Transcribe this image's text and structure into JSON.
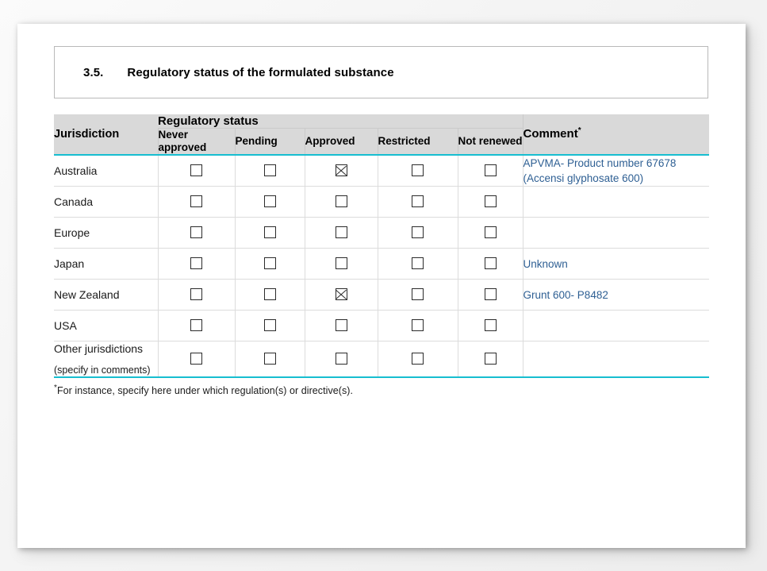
{
  "document": {
    "section_number": "3.5.",
    "section_title": "Regulatory status of the formulated substance"
  },
  "table": {
    "group_header": "Regulatory status",
    "jurisdiction_header": "Jurisdiction",
    "comment_header": "Comment",
    "comment_header_marker": "*",
    "status_columns": [
      "Never approved",
      "Pending",
      "Approved",
      "Restricted",
      "Not renewed"
    ],
    "rows": [
      {
        "jurisdiction": "Australia",
        "jurisdiction_sub": "",
        "never_approved": "unchecked",
        "pending": "unchecked",
        "approved": "checked",
        "restricted": "unchecked",
        "not_renewed": "unchecked",
        "comment": "APVMA- Product number 67678 (Accensi glyphosate 600)"
      },
      {
        "jurisdiction": "Canada",
        "jurisdiction_sub": "",
        "never_approved": "unchecked",
        "pending": "unchecked",
        "approved": "unchecked",
        "restricted": "unchecked",
        "not_renewed": "unchecked",
        "comment": ""
      },
      {
        "jurisdiction": "Europe",
        "jurisdiction_sub": "",
        "never_approved": "unchecked",
        "pending": "unchecked",
        "approved": "unchecked",
        "restricted": "unchecked",
        "not_renewed": "unchecked",
        "comment": ""
      },
      {
        "jurisdiction": "Japan",
        "jurisdiction_sub": "",
        "never_approved": "unchecked",
        "pending": "unchecked",
        "approved": "unchecked",
        "restricted": "unchecked",
        "not_renewed": "unchecked",
        "comment": "Unknown"
      },
      {
        "jurisdiction": "New Zealand",
        "jurisdiction_sub": "",
        "never_approved": "unchecked",
        "pending": "unchecked",
        "approved": "checked",
        "restricted": "unchecked",
        "not_renewed": "unchecked",
        "comment": "Grunt 600- P8482"
      },
      {
        "jurisdiction": "USA",
        "jurisdiction_sub": "",
        "never_approved": "unchecked",
        "pending": "unchecked",
        "approved": "unchecked",
        "restricted": "unchecked",
        "not_renewed": "unchecked",
        "comment": ""
      },
      {
        "jurisdiction": "Other jurisdictions",
        "jurisdiction_sub": "(specify in comments)",
        "never_approved": "unchecked",
        "pending": "unchecked",
        "approved": "unchecked",
        "restricted": "unchecked",
        "not_renewed": "unchecked",
        "comment": ""
      }
    ]
  },
  "footnote": {
    "marker": "*",
    "text": "For instance, specify here under which regulation(s) or directive(s)."
  },
  "colors": {
    "accent_rule": "#17bed0",
    "header_fill": "#d9d9d9",
    "comment_text": "#2e5f93",
    "page_background": "#f2f2f2"
  }
}
